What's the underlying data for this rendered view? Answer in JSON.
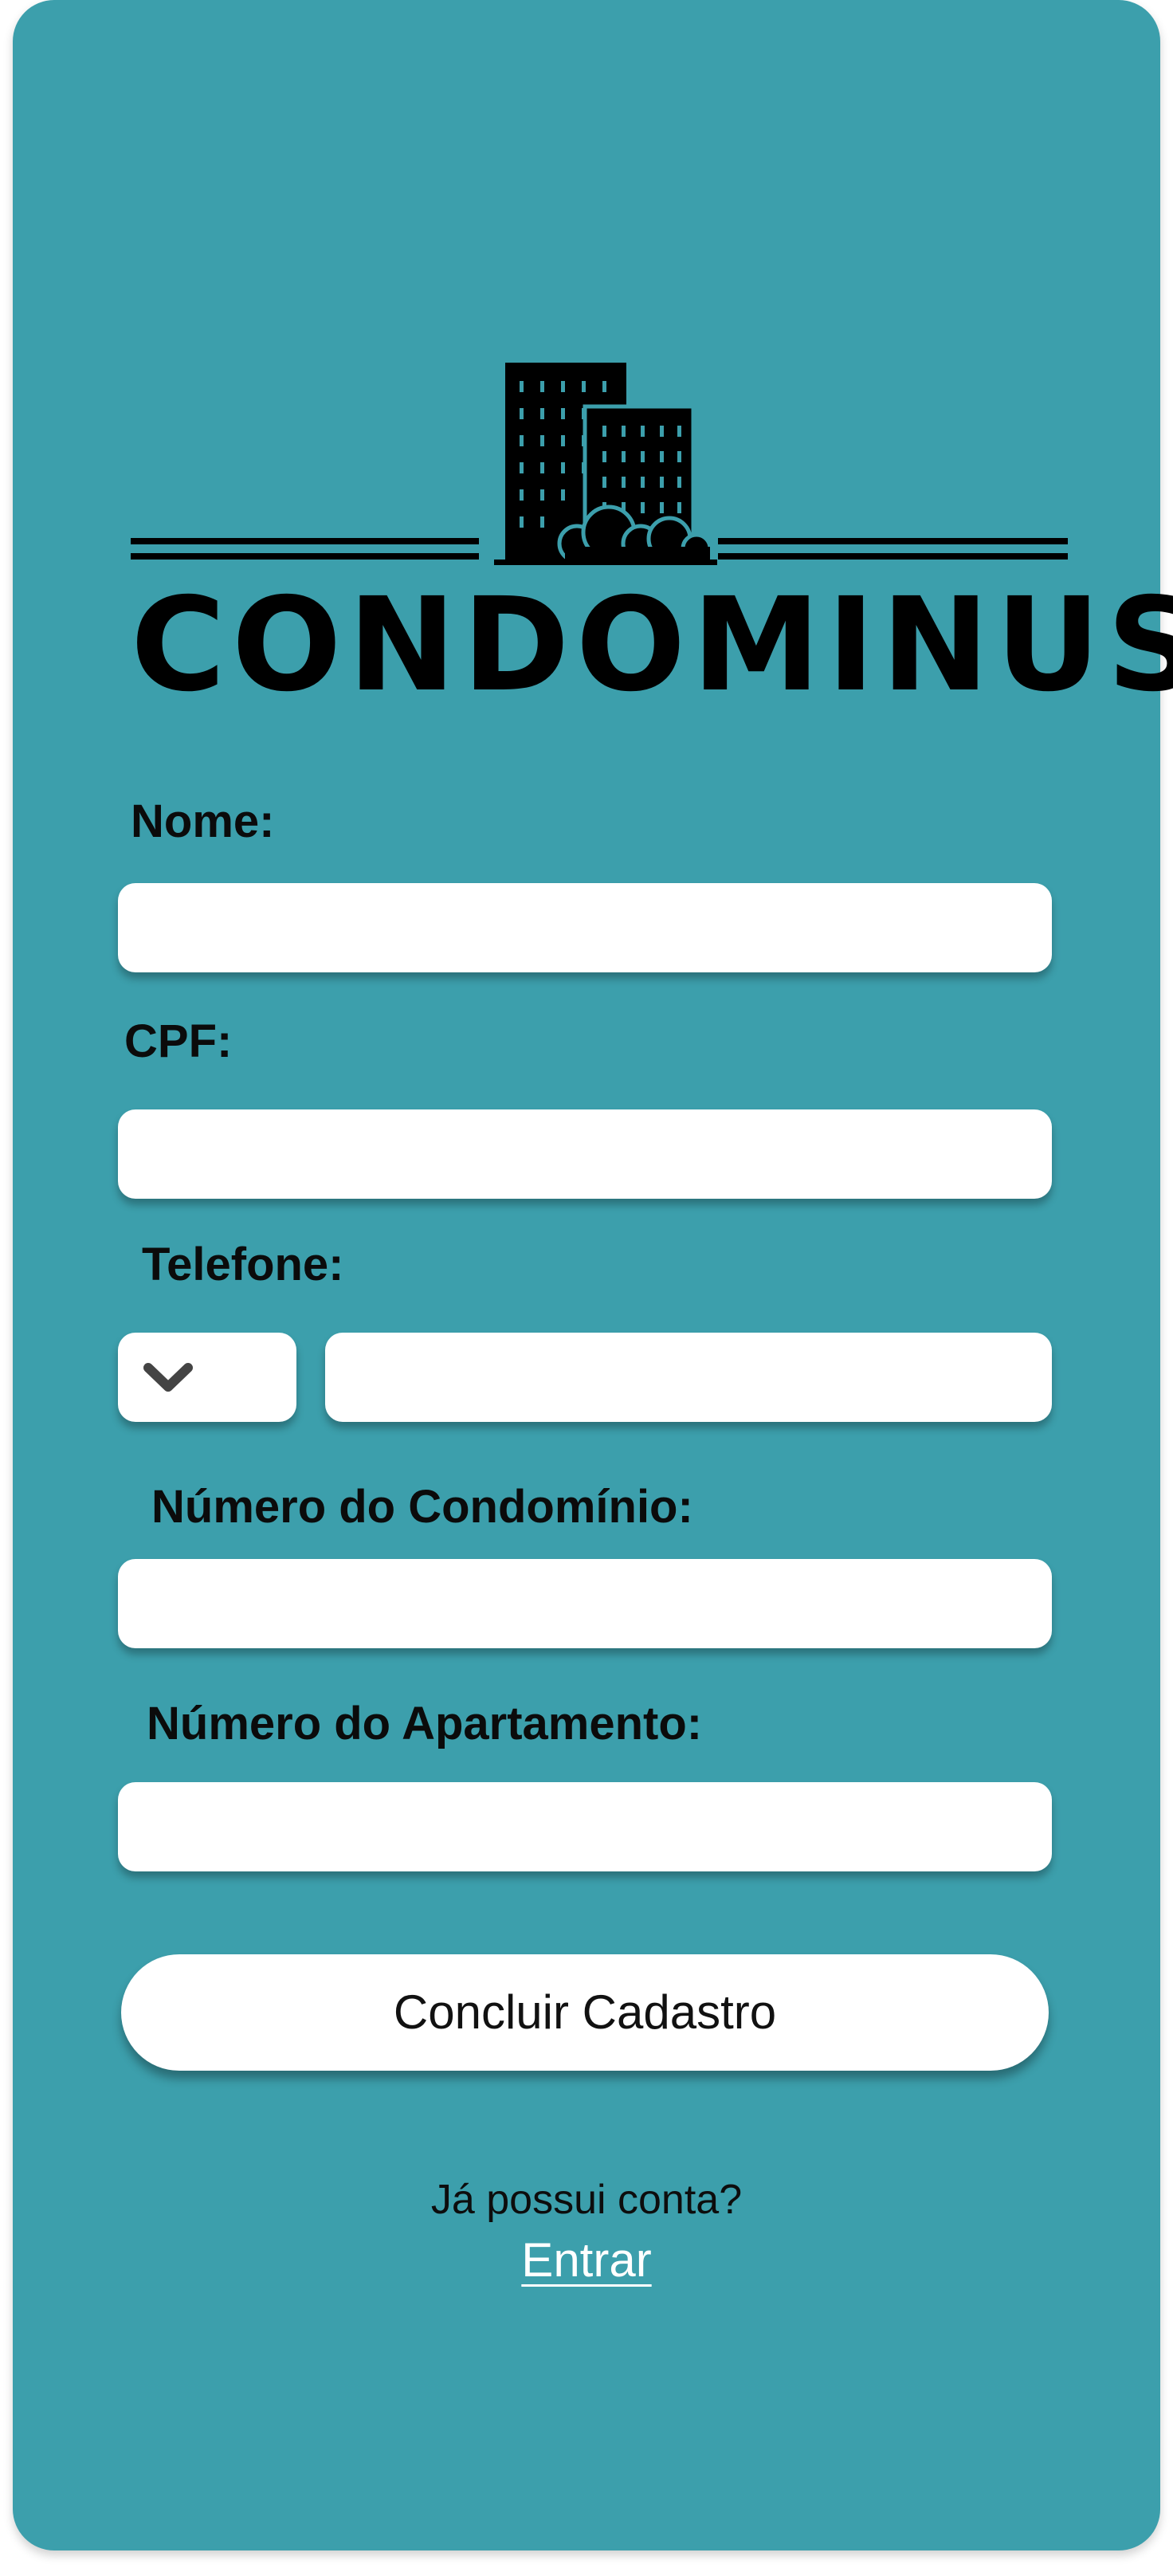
{
  "app": {
    "logo_text": "CONDOMINUS"
  },
  "form": {
    "name_label": "Nome:",
    "name_value": "",
    "cpf_label": "CPF:",
    "cpf_value": "",
    "phone_label": "Telefone:",
    "phone_code_value": "",
    "phone_value": "",
    "condo_number_label": "Número do Condomínio:",
    "condo_number_value": "",
    "apartment_number_label": "Número do Apartamento:",
    "apartment_number_value": "",
    "submit_label": "Concluir Cadastro"
  },
  "footer": {
    "question": "Já possui conta?",
    "login_link": "Entrar"
  },
  "icons": {
    "logo": "buildings-logo-icon",
    "dropdown": "chevron-down-icon"
  },
  "colors": {
    "background": "#3c9fac",
    "field": "#ffffff",
    "text": "#0b0b0b",
    "link": "#ffffff"
  }
}
